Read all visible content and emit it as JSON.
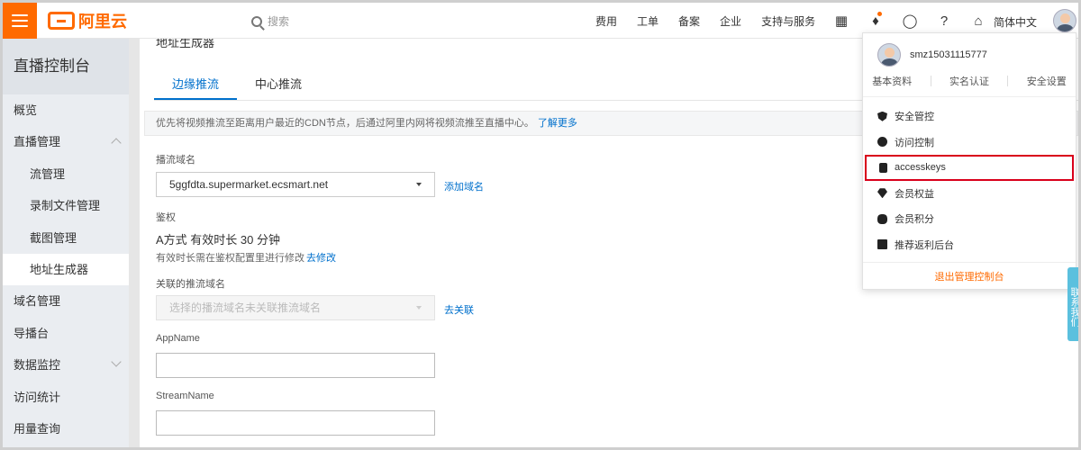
{
  "header": {
    "logo_text": "阿里云",
    "search_placeholder": "搜索",
    "nav": [
      "费用",
      "工单",
      "备案",
      "企业",
      "支持与服务"
    ],
    "language": "简体中文"
  },
  "sidebar": {
    "title": "直播控制台",
    "items": [
      {
        "label": "概览"
      },
      {
        "label": "直播管理"
      },
      {
        "label": "流管理"
      },
      {
        "label": "录制文件管理"
      },
      {
        "label": "截图管理"
      },
      {
        "label": "地址生成器"
      },
      {
        "label": "域名管理"
      },
      {
        "label": "导播台"
      },
      {
        "label": "数据监控"
      },
      {
        "label": "访问统计"
      },
      {
        "label": "用量查询"
      }
    ]
  },
  "main": {
    "partial_heading": "地址生成器",
    "tabs": [
      "边缘推流",
      "中心推流"
    ],
    "notice_text": "优先将视频推流至距离用户最近的CDN节点，后通过阿里内网将视频流推至直播中心。",
    "notice_link": "了解更多",
    "play_domain_label": "播流域名",
    "play_domain_value": "5ggfdta.supermarket.ecsmart.net",
    "add_domain_link": "添加域名",
    "auth_label": "鉴权",
    "auth_mode": "A方式 有效时长 30 分钟",
    "auth_hint": "有效时长需在鉴权配置里进行修改",
    "auth_modify_link": "去修改",
    "push_domain_label": "关联的推流域名",
    "push_domain_placeholder": "选择的播流域名未关联推流域名",
    "associate_link": "去关联",
    "appname_label": "AppName",
    "streamname_label": "StreamName"
  },
  "dropdown": {
    "username": "smz15031115777",
    "links": [
      "基本资料",
      "实名认证",
      "安全设置"
    ],
    "menu": [
      {
        "label": "安全管控",
        "icon": "shield-icon"
      },
      {
        "label": "访问控制",
        "icon": "user-icon"
      },
      {
        "label": "accesskeys",
        "icon": "key-icon"
      },
      {
        "label": "会员权益",
        "icon": "diamond-icon"
      },
      {
        "label": "会员积分",
        "icon": "coin-icon"
      },
      {
        "label": "推荐返利后台",
        "icon": "book-icon"
      }
    ],
    "logout": "退出管理控制台"
  },
  "side_tab": "联系我们",
  "colors": {
    "brand": "#ff6a00",
    "link": "#0070cc",
    "highlight": "#d9001b"
  }
}
